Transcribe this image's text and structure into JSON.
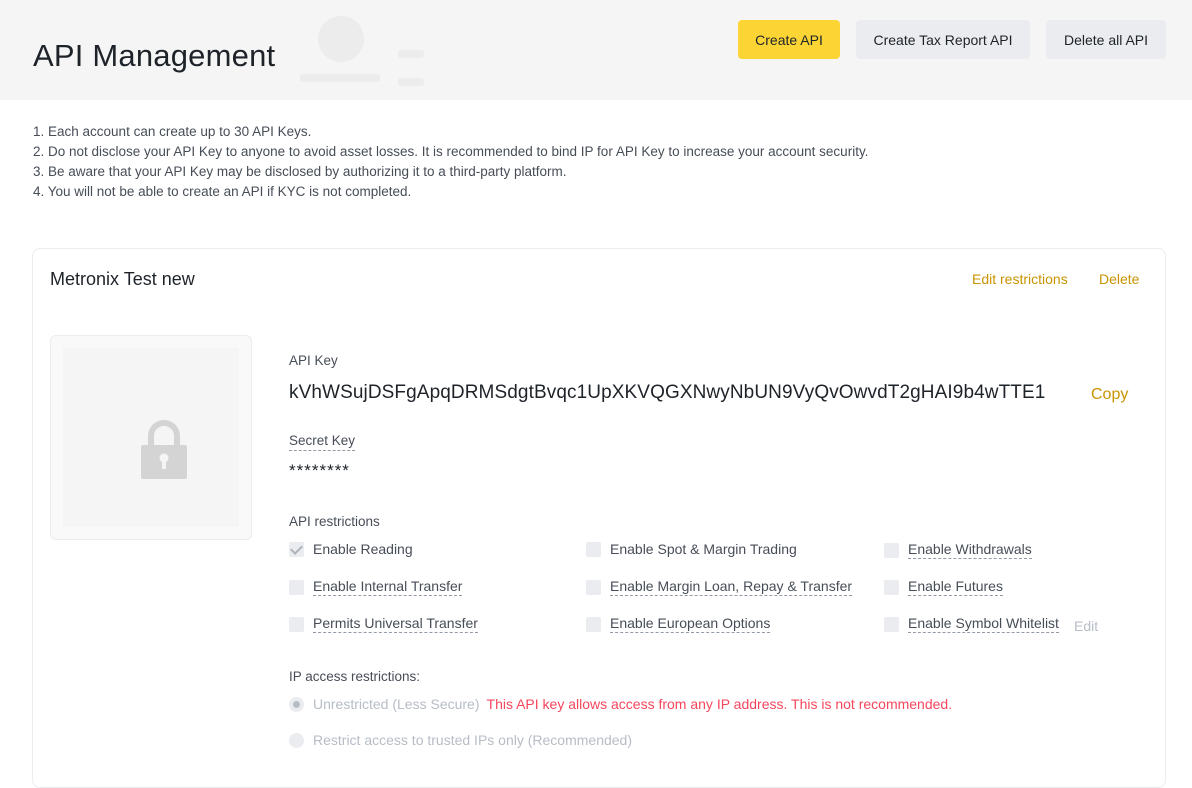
{
  "header": {
    "title": "API Management",
    "buttons": {
      "create": "Create API",
      "create_tax": "Create Tax Report API",
      "delete_all": "Delete all API"
    }
  },
  "notes": [
    "1. Each account can create up to 30 API Keys.",
    "2. Do not disclose your API Key to anyone to avoid asset losses. It is recommended to bind IP for API Key to increase your account security.",
    "3. Be aware that your API Key may be disclosed by authorizing it to a third-party platform.",
    "4. You will not be able to create an API if KYC is not completed."
  ],
  "card": {
    "name": "Metronix Test new",
    "edit_label": "Edit restrictions",
    "delete_label": "Delete",
    "qr_icon": "lock-icon",
    "api_key_label": "API Key",
    "api_key": "kVhWSujDSFgApqDRMSdgtBvqc1UpXKVQGXNwyNbUN9VyQvOwvdT2gHAI9b4wTTE1",
    "copy_label": "Copy",
    "secret_key_label": "Secret Key",
    "secret_key": "********",
    "restrictions_label": "API restrictions",
    "permissions": [
      {
        "label": "Enable Reading",
        "checked": true
      },
      {
        "label": "Enable Spot & Margin Trading",
        "checked": false
      },
      {
        "label": "Enable Withdrawals",
        "checked": false
      },
      {
        "label": "Enable Internal Transfer",
        "checked": false
      },
      {
        "label": "Enable Margin Loan, Repay & Transfer",
        "checked": false
      },
      {
        "label": "Enable Futures",
        "checked": false
      },
      {
        "label": "Permits Universal Transfer",
        "checked": false
      },
      {
        "label": "Enable European Options",
        "checked": false
      },
      {
        "label": "Enable Symbol Whitelist",
        "checked": false
      }
    ],
    "whitelist_edit": "Edit",
    "ip_label": "IP access restrictions:",
    "ip_options": {
      "unrestricted": "Unrestricted (Less Secure)",
      "warning": "This API key allows access from any IP address. This is not recommended.",
      "restricted": "Restrict access to trusted IPs only (Recommended)"
    },
    "ip_selected": "unrestricted"
  },
  "colors": {
    "accent": "#fcd535",
    "link": "#c99400",
    "warning": "#f6465d"
  }
}
